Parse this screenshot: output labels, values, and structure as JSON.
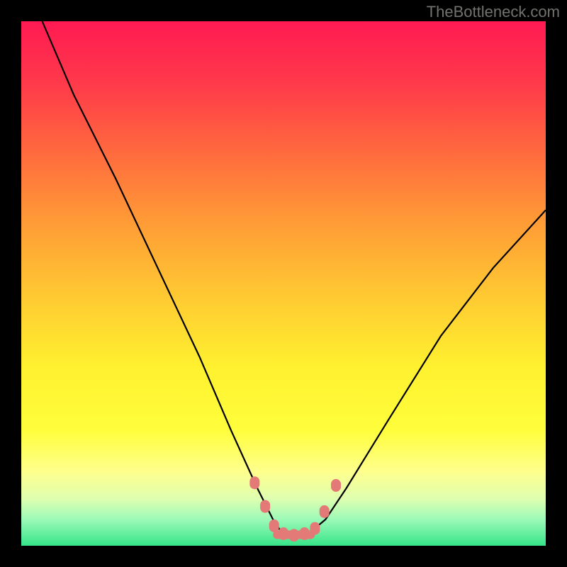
{
  "watermark": "TheBottleneck.com",
  "chart_data": {
    "type": "line",
    "title": "",
    "xlabel": "",
    "ylabel": "",
    "xlim": [
      0,
      100
    ],
    "ylim": [
      0,
      100
    ],
    "grid": false,
    "series": [
      {
        "name": "curve",
        "x": [
          4,
          10,
          18,
          26,
          34,
          40,
          45,
          48,
          50,
          52,
          55,
          58,
          62,
          70,
          80,
          90,
          100
        ],
        "values": [
          100,
          86,
          70,
          53,
          36,
          22,
          11,
          5,
          2,
          1.5,
          2.5,
          5,
          11,
          24,
          40,
          53,
          64
        ]
      }
    ],
    "markers": [
      {
        "x": 44.5,
        "y": 12
      },
      {
        "x": 46.5,
        "y": 7.5
      },
      {
        "x": 48.2,
        "y": 3.8
      },
      {
        "x": 50.0,
        "y": 2.3
      },
      {
        "x": 52.0,
        "y": 2.0
      },
      {
        "x": 54.0,
        "y": 2.3
      },
      {
        "x": 56.0,
        "y": 3.3
      },
      {
        "x": 57.8,
        "y": 6.5
      },
      {
        "x": 60.0,
        "y": 11.5
      }
    ],
    "flat_segment": {
      "x0": 48,
      "x1": 56,
      "y": 2.1
    }
  }
}
